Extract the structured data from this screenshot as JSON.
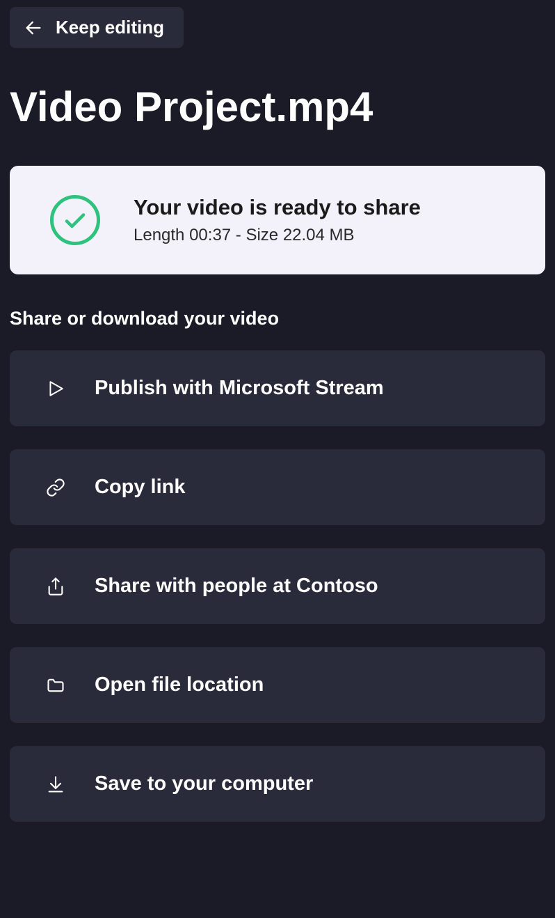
{
  "header": {
    "back_button_label": "Keep editing"
  },
  "title": "Video Project.mp4",
  "status": {
    "title": "Your video is ready to share",
    "details": "Length 00:37 - Size 22.04 MB"
  },
  "section_heading": "Share or download your video",
  "actions": [
    {
      "label": "Publish with Microsoft Stream",
      "icon": "play-icon"
    },
    {
      "label": "Copy link",
      "icon": "link-icon"
    },
    {
      "label": "Share with people at Contoso",
      "icon": "share-icon"
    },
    {
      "label": "Open file location",
      "icon": "folder-icon"
    },
    {
      "label": "Save to your computer",
      "icon": "download-icon"
    }
  ]
}
